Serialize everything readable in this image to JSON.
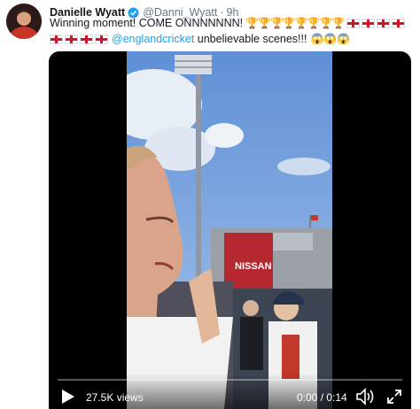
{
  "tweet": {
    "author": {
      "display_name": "Danielle Wyatt",
      "handle": "@Danni_Wyatt",
      "verified_icon": "verified-badge-icon",
      "avatar_color": "#c73428"
    },
    "separator": "·",
    "time": "9h",
    "text_line1": "Winning moment! COME ONNNNNNN!",
    "trophies": "🏆🏆🏆🏆🏆🏆🏆🏆",
    "mention": "@englandcricket",
    "text_line2_after": " unbelievable scenes!!!",
    "scared_emojis": "😱😱😱",
    "flags_line1_count": 4,
    "flags_line2_count": 4,
    "colors": {
      "link": "#1da1f2",
      "text": "#14171a",
      "muted": "#657786",
      "flag_red": "#cf142b"
    }
  },
  "video": {
    "views": "27.5K views",
    "timecode": "0:00 / 0:14",
    "progress": 0,
    "scoreboard_text": "NISSAN",
    "icons": {
      "play": "play-icon",
      "volume": "volume-icon",
      "fullscreen": "fullscreen-icon"
    }
  }
}
